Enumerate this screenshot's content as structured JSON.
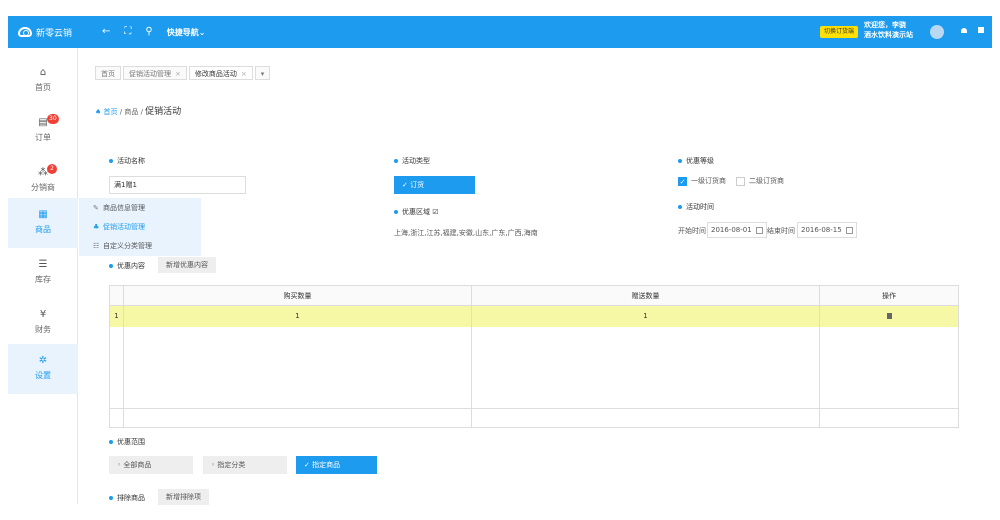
{
  "topbar": {
    "brand": "新零云销",
    "icons": [
      "back-arrow-icon",
      "fullscreen-icon",
      "search-icon"
    ],
    "quicknav": "快捷导航",
    "switch_btn": "切换订货端",
    "welcome_line1": "欢迎您，李骁",
    "welcome_line2": "酒水饮料演示站"
  },
  "sidebar": {
    "items": [
      {
        "label": "首页",
        "icon": "home-icon"
      },
      {
        "label": "订单",
        "icon": "order-icon",
        "badge": "30"
      },
      {
        "label": "分销商",
        "icon": "users-icon",
        "badge": "2"
      },
      {
        "label": "商品",
        "icon": "goods-icon"
      },
      {
        "label": "库存",
        "icon": "inventory-icon"
      },
      {
        "label": "财务",
        "icon": "finance-icon"
      },
      {
        "label": "设置",
        "icon": "settings-icon"
      }
    ],
    "submenu": [
      {
        "label": "商品信息管理",
        "icon": "edit-icon"
      },
      {
        "label": "促销活动管理",
        "icon": "promo-icon"
      },
      {
        "label": "自定义分类管理",
        "icon": "list-icon"
      }
    ]
  },
  "tabs": [
    {
      "label": "首页"
    },
    {
      "label": "促销活动管理"
    },
    {
      "label": "修改商品活动"
    }
  ],
  "breadcrumb": {
    "home": "首页",
    "sep": "/",
    "level1": "商品",
    "current": "促销活动"
  },
  "form": {
    "name_label": "活动名称",
    "name_value": "满1赠1",
    "type_label": "活动类型",
    "type_value": "订货",
    "level_label": "优惠等级",
    "level_opt1": "一级订货商",
    "level_opt2": "二级订货商",
    "area_label": "优惠区域",
    "area_value": "上海,浙江,江苏,福建,安徽,山东,广东,广西,海南",
    "time_label": "活动时间",
    "start_label": "开始时间",
    "start_value": "2016-08-01",
    "end_label": "结束时间",
    "end_value": "2016-08-15",
    "content_label": "优惠内容",
    "add_content_btn": "新增优惠内容",
    "scope_label": "优惠范围",
    "scope_all": "全部商品",
    "scope_cat": "指定分类",
    "scope_goods": "指定商品",
    "exclude_label": "排除商品",
    "add_exclude_btn": "新增排除项"
  },
  "table": {
    "headers": [
      "",
      "购买数量",
      "赠送数量",
      "操作"
    ],
    "rows": [
      {
        "index": "1",
        "buy": "1",
        "gift": "1"
      }
    ]
  }
}
